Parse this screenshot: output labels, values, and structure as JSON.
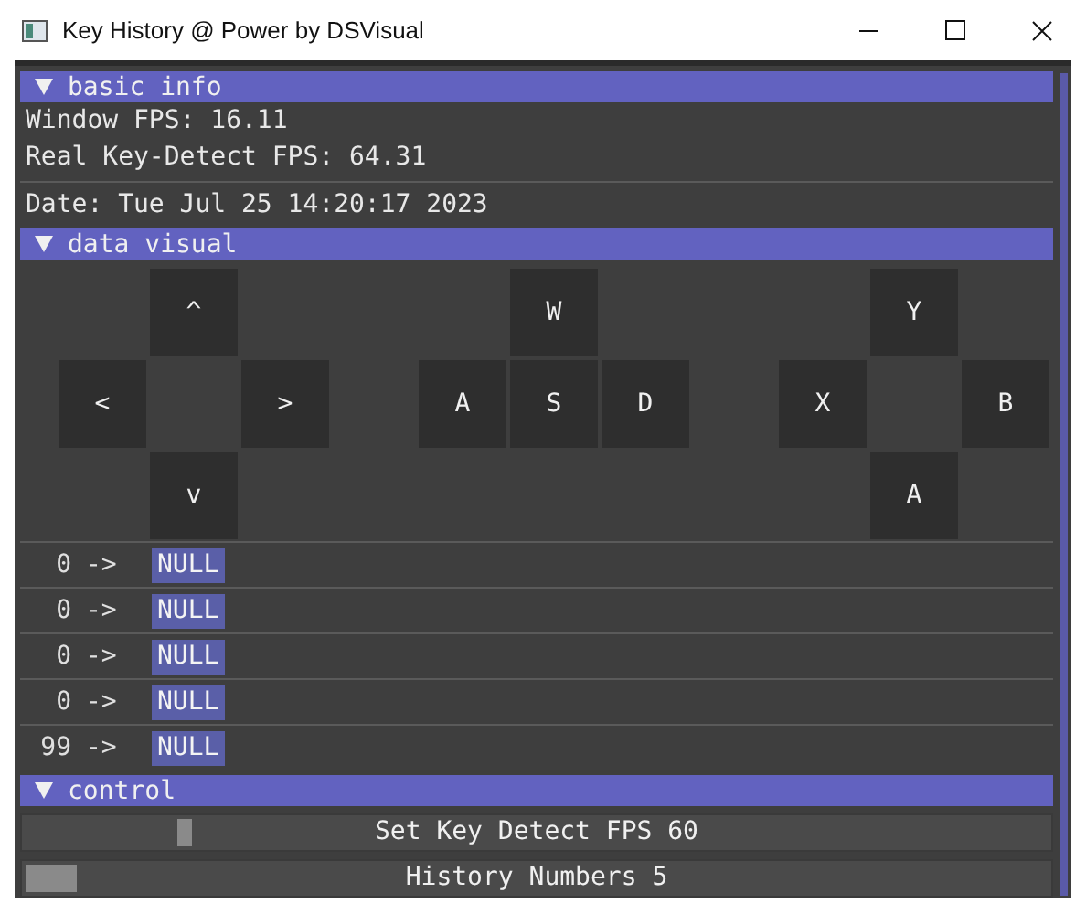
{
  "window": {
    "title": "Key History @ Power by DSVisual"
  },
  "sections": [
    {
      "title": "basic info",
      "expanded": true,
      "lines": [
        "Window FPS: 16.11",
        "Real Key-Detect FPS: 64.31",
        "Date: Tue Jul 25 14:20:17 2023"
      ]
    },
    {
      "title": "data visual",
      "expanded": true,
      "pads": [
        {
          "keys": [
            {
              "label": "^",
              "kind": "up"
            },
            {
              "label": "<",
              "kind": "left"
            },
            {
              "label": ">",
              "kind": "right"
            },
            {
              "label": "v",
              "kind": "down"
            }
          ]
        },
        {
          "keys": [
            {
              "label": "W",
              "kind": "up"
            },
            {
              "label": "A",
              "kind": "left"
            },
            {
              "label": "S",
              "kind": "center"
            },
            {
              "label": "D",
              "kind": "right"
            }
          ]
        },
        {
          "keys": [
            {
              "label": "Y",
              "kind": "up"
            },
            {
              "label": "X",
              "kind": "left"
            },
            {
              "label": "B",
              "kind": "right"
            },
            {
              "label": "A",
              "kind": "down"
            }
          ]
        }
      ],
      "history": [
        {
          "count": "0",
          "arrow": "->",
          "key": "NULL"
        },
        {
          "count": "0",
          "arrow": "->",
          "key": "NULL"
        },
        {
          "count": "0",
          "arrow": "->",
          "key": "NULL"
        },
        {
          "count": "0",
          "arrow": "->",
          "key": "NULL"
        },
        {
          "count": "99",
          "arrow": "->",
          "key": "NULL"
        }
      ]
    },
    {
      "title": "control",
      "expanded": true,
      "sliders": [
        {
          "label": "Set Key Detect FPS 60",
          "level": 0.15,
          "kind": "narrow"
        },
        {
          "label": "History Numbers 5",
          "level": 0,
          "kind": "wide"
        }
      ]
    }
  ]
}
